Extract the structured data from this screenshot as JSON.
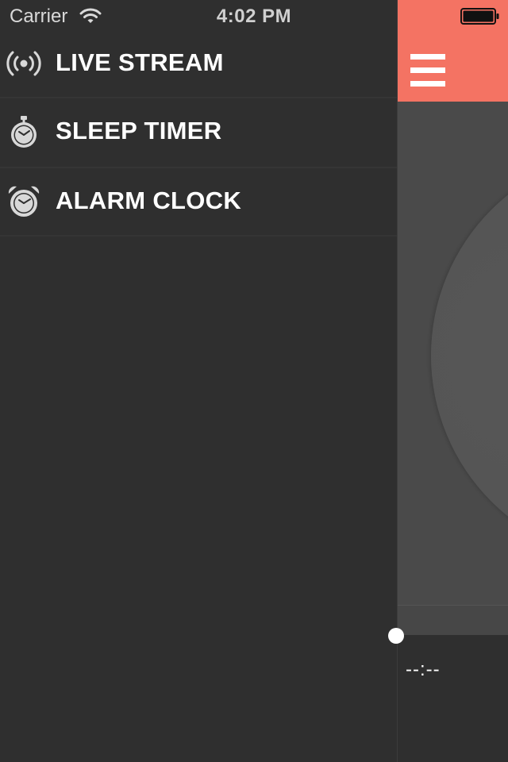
{
  "status_bar": {
    "carrier": "Carrier",
    "time": "4:02 PM"
  },
  "menu": {
    "items": [
      {
        "label": "LIVE STREAM",
        "icon": "broadcast-icon"
      },
      {
        "label": "SLEEP TIMER",
        "icon": "stopwatch-icon"
      },
      {
        "label": "ALARM CLOCK",
        "icon": "alarm-clock-icon"
      }
    ]
  },
  "main": {
    "nav_bar_color": "#f47363",
    "menu_icon": "hamburger-menu-icon",
    "elapsed_time": "--:--"
  },
  "colors": {
    "menu_background": "#2f2f2f",
    "accent": "#f47363",
    "text": "#ffffff"
  }
}
